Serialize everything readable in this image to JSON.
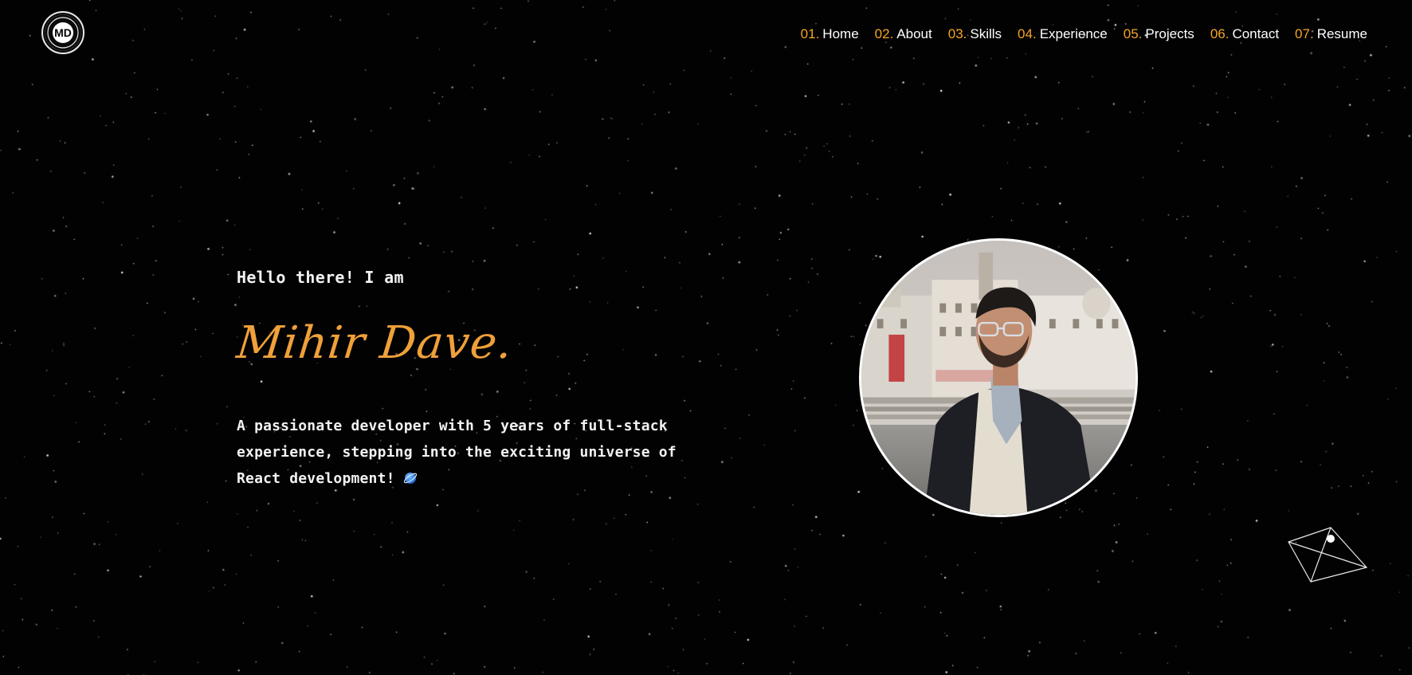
{
  "logo": {
    "initials": "MD",
    "icon": "md-monogram-seal-logo"
  },
  "nav": [
    {
      "num": "01.",
      "label": "Home"
    },
    {
      "num": "02.",
      "label": "About"
    },
    {
      "num": "03.",
      "label": "Skills"
    },
    {
      "num": "04.",
      "label": "Experience"
    },
    {
      "num": "05.",
      "label": "Projects"
    },
    {
      "num": "06.",
      "label": "Contact"
    },
    {
      "num": "07.",
      "label": "Resume"
    }
  ],
  "hero": {
    "greeting": "Hello there! I am",
    "name": "Mihir Dave.",
    "tagline": "A passionate developer with 5 years of full-stack experience, stepping into the exciting universe of React development!",
    "tagline_icon": "blue-planet-emoji-icon"
  },
  "profile_photo": {
    "icon": "profile-photo"
  },
  "colors": {
    "background": "#020202",
    "accent": "#f5a524",
    "name": "#f0a03a",
    "text": "#f2f2f2"
  },
  "decor": {
    "corner_icon": "wireframe-pyramid-icon"
  }
}
